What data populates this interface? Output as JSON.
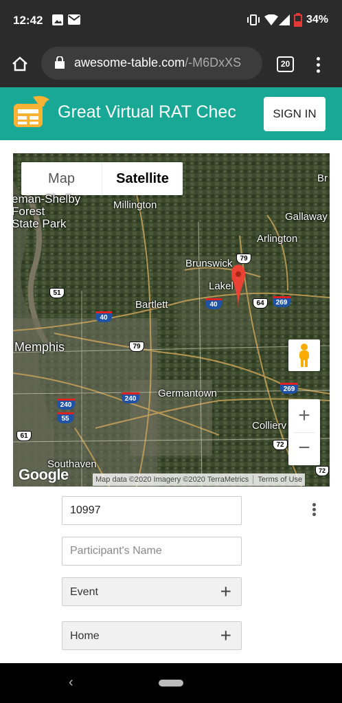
{
  "status_bar": {
    "time": "12:42",
    "battery": "34%"
  },
  "browser": {
    "url_host": "awesome-table.com",
    "url_path": "/-M6DxXS",
    "tab_count": "20"
  },
  "app_bar": {
    "title": "Great Virtual RAT Chec",
    "sign_in_label": "SIGN IN",
    "accent_color": "#1aa896"
  },
  "map": {
    "type_map_label": "Map",
    "type_satellite_label": "Satellite",
    "selected_type": "Satellite",
    "place_labels": {
      "shelby": "eman-Shelby\nForest\nState Park",
      "millington": "Millington",
      "gallaway": "Gallaway",
      "arlington": "Arlington",
      "brunswick": "Brunswick",
      "lakeland": "Lakel",
      "bartlett": "Bartlett",
      "memphis": "Memphis",
      "germantown": "Germantown",
      "collierville": "Collierv",
      "southaven": "Southaven",
      "br": "Br"
    },
    "route_shields": {
      "us51": "51",
      "us79a": "79",
      "i40a": "40",
      "i40b": "40",
      "us64": "64",
      "i269a": "269",
      "us79b": "79",
      "i269b": "269",
      "i240a": "240",
      "i240b": "240",
      "i55": "55",
      "us61": "61",
      "us72a": "72",
      "us72b": "72"
    },
    "zoom_in_label": "+",
    "zoom_out_label": "−",
    "google_logo": "Google",
    "attribution": "Map data ©2020 Imagery ©2020 TerraMetrics",
    "terms_label": "Terms of Use"
  },
  "form": {
    "id_value": "10997",
    "name_placeholder": "Participant's Name",
    "event_label": "Event",
    "home_label": "Home",
    "plus_icon": "+"
  }
}
